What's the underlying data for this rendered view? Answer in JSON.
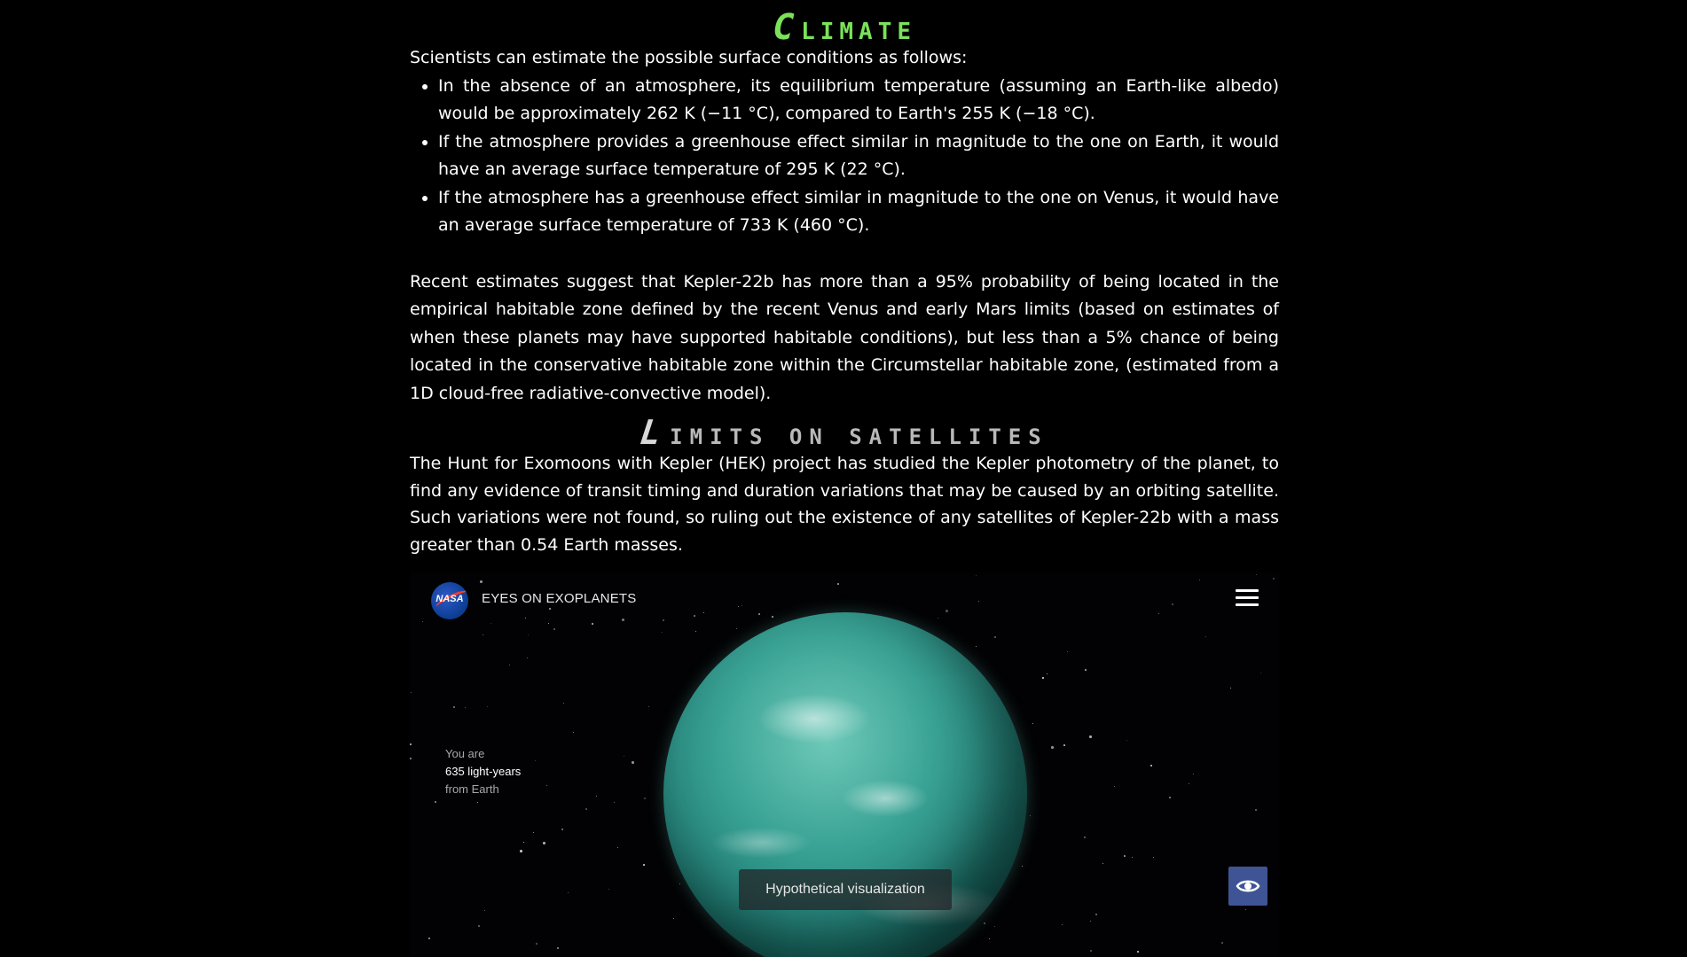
{
  "article": {
    "climate": {
      "heading_first": "C",
      "heading_rest": "limate",
      "intro": "Scientists can estimate the possible surface conditions as follows:",
      "bullets": [
        "In the absence of an atmosphere, its equilibrium temperature (assuming an Earth-like albedo) would be approximately 262 K (−11 °C), compared to Earth's 255 K (−18 °C).",
        "If the atmosphere provides a greenhouse effect similar in magnitude to the one on Earth, it would have an average surface temperature of 295 K (22 °C).",
        "If the atmosphere has a greenhouse effect similar in magnitude to the one on Venus, it would have an average surface temperature of 733 K (460 °C)."
      ],
      "paragraph": "Recent estimates suggest that Kepler-22b has more than a 95% probability of being located in the empirical habitable zone defined by the recent Venus and early Mars limits (based on estimates of when these planets may have supported habitable conditions), but less than a 5% chance of being located in the conservative habitable zone within the Circumstellar habitable zone, (estimated from a 1D cloud-free radiative-convective model)."
    },
    "satellites": {
      "heading_first": "L",
      "heading_rest": "imits on satellites",
      "paragraph": "The Hunt for Exomoons with Kepler (HEK) project has studied the Kepler photometry of the planet, to find any evidence of transit timing and duration variations that may be caused by an orbiting satellite. Such variations were not found, so ruling out the existence of any satellites of Kepler-22b with a mass greater than 0.54 Earth masses."
    }
  },
  "viewer": {
    "logo_text": "NASA",
    "title": "EYES ON EXOPLANETS",
    "distance_prefix": "You are",
    "distance_value": "635 light-years",
    "distance_suffix": "from Earth",
    "caption": "Hypothetical visualization",
    "icons": {
      "menu": "hamburger-menu-icon",
      "view": "eye-icon"
    }
  },
  "colors": {
    "background": "#000000",
    "climate_heading": "#7be15a",
    "satellites_heading": "#b9b9b9",
    "eye_button": "#3f5495"
  }
}
